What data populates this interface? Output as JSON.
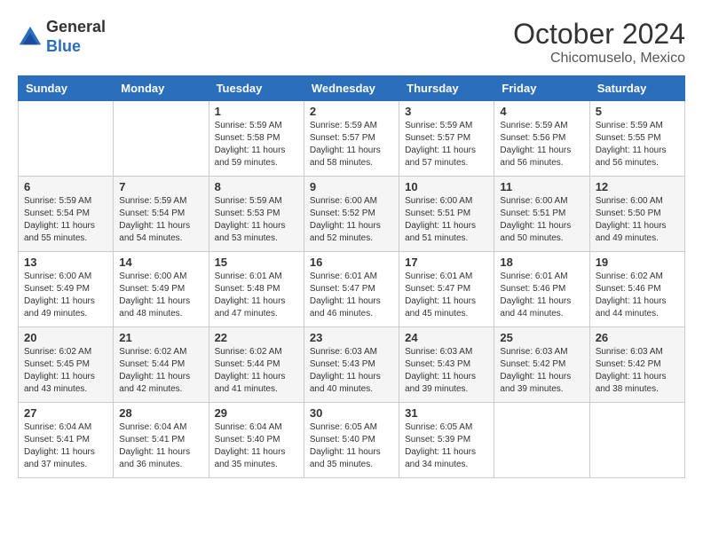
{
  "header": {
    "logo": {
      "general": "General",
      "blue": "Blue"
    },
    "title": "October 2024",
    "subtitle": "Chicomuselo, Mexico"
  },
  "days_of_week": [
    "Sunday",
    "Monday",
    "Tuesday",
    "Wednesday",
    "Thursday",
    "Friday",
    "Saturday"
  ],
  "weeks": [
    [
      {
        "day": "",
        "info": ""
      },
      {
        "day": "",
        "info": ""
      },
      {
        "day": "1",
        "info": "Sunrise: 5:59 AM\nSunset: 5:58 PM\nDaylight: 11 hours and 59 minutes."
      },
      {
        "day": "2",
        "info": "Sunrise: 5:59 AM\nSunset: 5:57 PM\nDaylight: 11 hours and 58 minutes."
      },
      {
        "day": "3",
        "info": "Sunrise: 5:59 AM\nSunset: 5:57 PM\nDaylight: 11 hours and 57 minutes."
      },
      {
        "day": "4",
        "info": "Sunrise: 5:59 AM\nSunset: 5:56 PM\nDaylight: 11 hours and 56 minutes."
      },
      {
        "day": "5",
        "info": "Sunrise: 5:59 AM\nSunset: 5:55 PM\nDaylight: 11 hours and 56 minutes."
      }
    ],
    [
      {
        "day": "6",
        "info": "Sunrise: 5:59 AM\nSunset: 5:54 PM\nDaylight: 11 hours and 55 minutes."
      },
      {
        "day": "7",
        "info": "Sunrise: 5:59 AM\nSunset: 5:54 PM\nDaylight: 11 hours and 54 minutes."
      },
      {
        "day": "8",
        "info": "Sunrise: 5:59 AM\nSunset: 5:53 PM\nDaylight: 11 hours and 53 minutes."
      },
      {
        "day": "9",
        "info": "Sunrise: 6:00 AM\nSunset: 5:52 PM\nDaylight: 11 hours and 52 minutes."
      },
      {
        "day": "10",
        "info": "Sunrise: 6:00 AM\nSunset: 5:51 PM\nDaylight: 11 hours and 51 minutes."
      },
      {
        "day": "11",
        "info": "Sunrise: 6:00 AM\nSunset: 5:51 PM\nDaylight: 11 hours and 50 minutes."
      },
      {
        "day": "12",
        "info": "Sunrise: 6:00 AM\nSunset: 5:50 PM\nDaylight: 11 hours and 49 minutes."
      }
    ],
    [
      {
        "day": "13",
        "info": "Sunrise: 6:00 AM\nSunset: 5:49 PM\nDaylight: 11 hours and 49 minutes."
      },
      {
        "day": "14",
        "info": "Sunrise: 6:00 AM\nSunset: 5:49 PM\nDaylight: 11 hours and 48 minutes."
      },
      {
        "day": "15",
        "info": "Sunrise: 6:01 AM\nSunset: 5:48 PM\nDaylight: 11 hours and 47 minutes."
      },
      {
        "day": "16",
        "info": "Sunrise: 6:01 AM\nSunset: 5:47 PM\nDaylight: 11 hours and 46 minutes."
      },
      {
        "day": "17",
        "info": "Sunrise: 6:01 AM\nSunset: 5:47 PM\nDaylight: 11 hours and 45 minutes."
      },
      {
        "day": "18",
        "info": "Sunrise: 6:01 AM\nSunset: 5:46 PM\nDaylight: 11 hours and 44 minutes."
      },
      {
        "day": "19",
        "info": "Sunrise: 6:02 AM\nSunset: 5:46 PM\nDaylight: 11 hours and 44 minutes."
      }
    ],
    [
      {
        "day": "20",
        "info": "Sunrise: 6:02 AM\nSunset: 5:45 PM\nDaylight: 11 hours and 43 minutes."
      },
      {
        "day": "21",
        "info": "Sunrise: 6:02 AM\nSunset: 5:44 PM\nDaylight: 11 hours and 42 minutes."
      },
      {
        "day": "22",
        "info": "Sunrise: 6:02 AM\nSunset: 5:44 PM\nDaylight: 11 hours and 41 minutes."
      },
      {
        "day": "23",
        "info": "Sunrise: 6:03 AM\nSunset: 5:43 PM\nDaylight: 11 hours and 40 minutes."
      },
      {
        "day": "24",
        "info": "Sunrise: 6:03 AM\nSunset: 5:43 PM\nDaylight: 11 hours and 39 minutes."
      },
      {
        "day": "25",
        "info": "Sunrise: 6:03 AM\nSunset: 5:42 PM\nDaylight: 11 hours and 39 minutes."
      },
      {
        "day": "26",
        "info": "Sunrise: 6:03 AM\nSunset: 5:42 PM\nDaylight: 11 hours and 38 minutes."
      }
    ],
    [
      {
        "day": "27",
        "info": "Sunrise: 6:04 AM\nSunset: 5:41 PM\nDaylight: 11 hours and 37 minutes."
      },
      {
        "day": "28",
        "info": "Sunrise: 6:04 AM\nSunset: 5:41 PM\nDaylight: 11 hours and 36 minutes."
      },
      {
        "day": "29",
        "info": "Sunrise: 6:04 AM\nSunset: 5:40 PM\nDaylight: 11 hours and 35 minutes."
      },
      {
        "day": "30",
        "info": "Sunrise: 6:05 AM\nSunset: 5:40 PM\nDaylight: 11 hours and 35 minutes."
      },
      {
        "day": "31",
        "info": "Sunrise: 6:05 AM\nSunset: 5:39 PM\nDaylight: 11 hours and 34 minutes."
      },
      {
        "day": "",
        "info": ""
      },
      {
        "day": "",
        "info": ""
      }
    ]
  ]
}
